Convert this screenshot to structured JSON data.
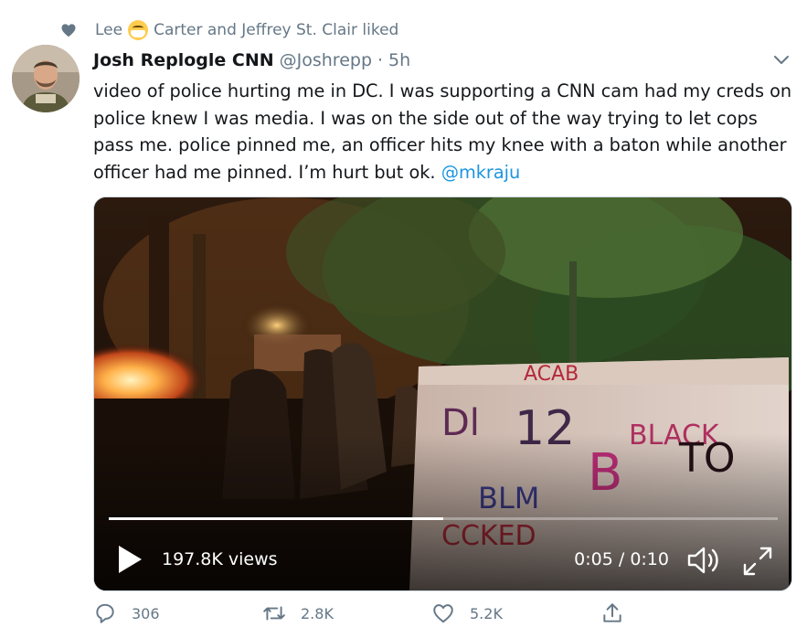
{
  "social_context": {
    "name_first": "Lee",
    "name_rest": "Carter and Jeffrey St. Clair liked"
  },
  "tweet": {
    "author_name": "Josh Replogle CNN",
    "author_handle": "@Joshrepp",
    "separator": "·",
    "time": "5h",
    "text": "video of police hurting me in DC. I was supporting a CNN cam had my creds on police knew I was media. I was on the side out of the way trying to let cops pass me. police pinned me, an officer hits my knee with a baton while another officer had me pinned. I’m hurt but ok.",
    "mention": "@mkraju"
  },
  "video": {
    "views": "197.8K views",
    "timecode": "0:05 / 0:10",
    "progress": 0.5
  },
  "actions": {
    "reply_count": "306",
    "retweet_count": "2.8K",
    "like_count": "5.2K"
  },
  "icons": {
    "liked": "heart-icon",
    "mask_emoji": "face-with-medical-mask-emoji",
    "caret": "chevron-down-icon",
    "play": "play-icon",
    "volume": "volume-icon",
    "fullscreen": "fullscreen-icon",
    "reply": "reply-icon",
    "retweet": "retweet-icon",
    "like": "like-icon",
    "share": "share-icon"
  },
  "colors": {
    "secondary_text": "#657786",
    "link": "#1b95e0",
    "primary_text": "#14171a"
  }
}
